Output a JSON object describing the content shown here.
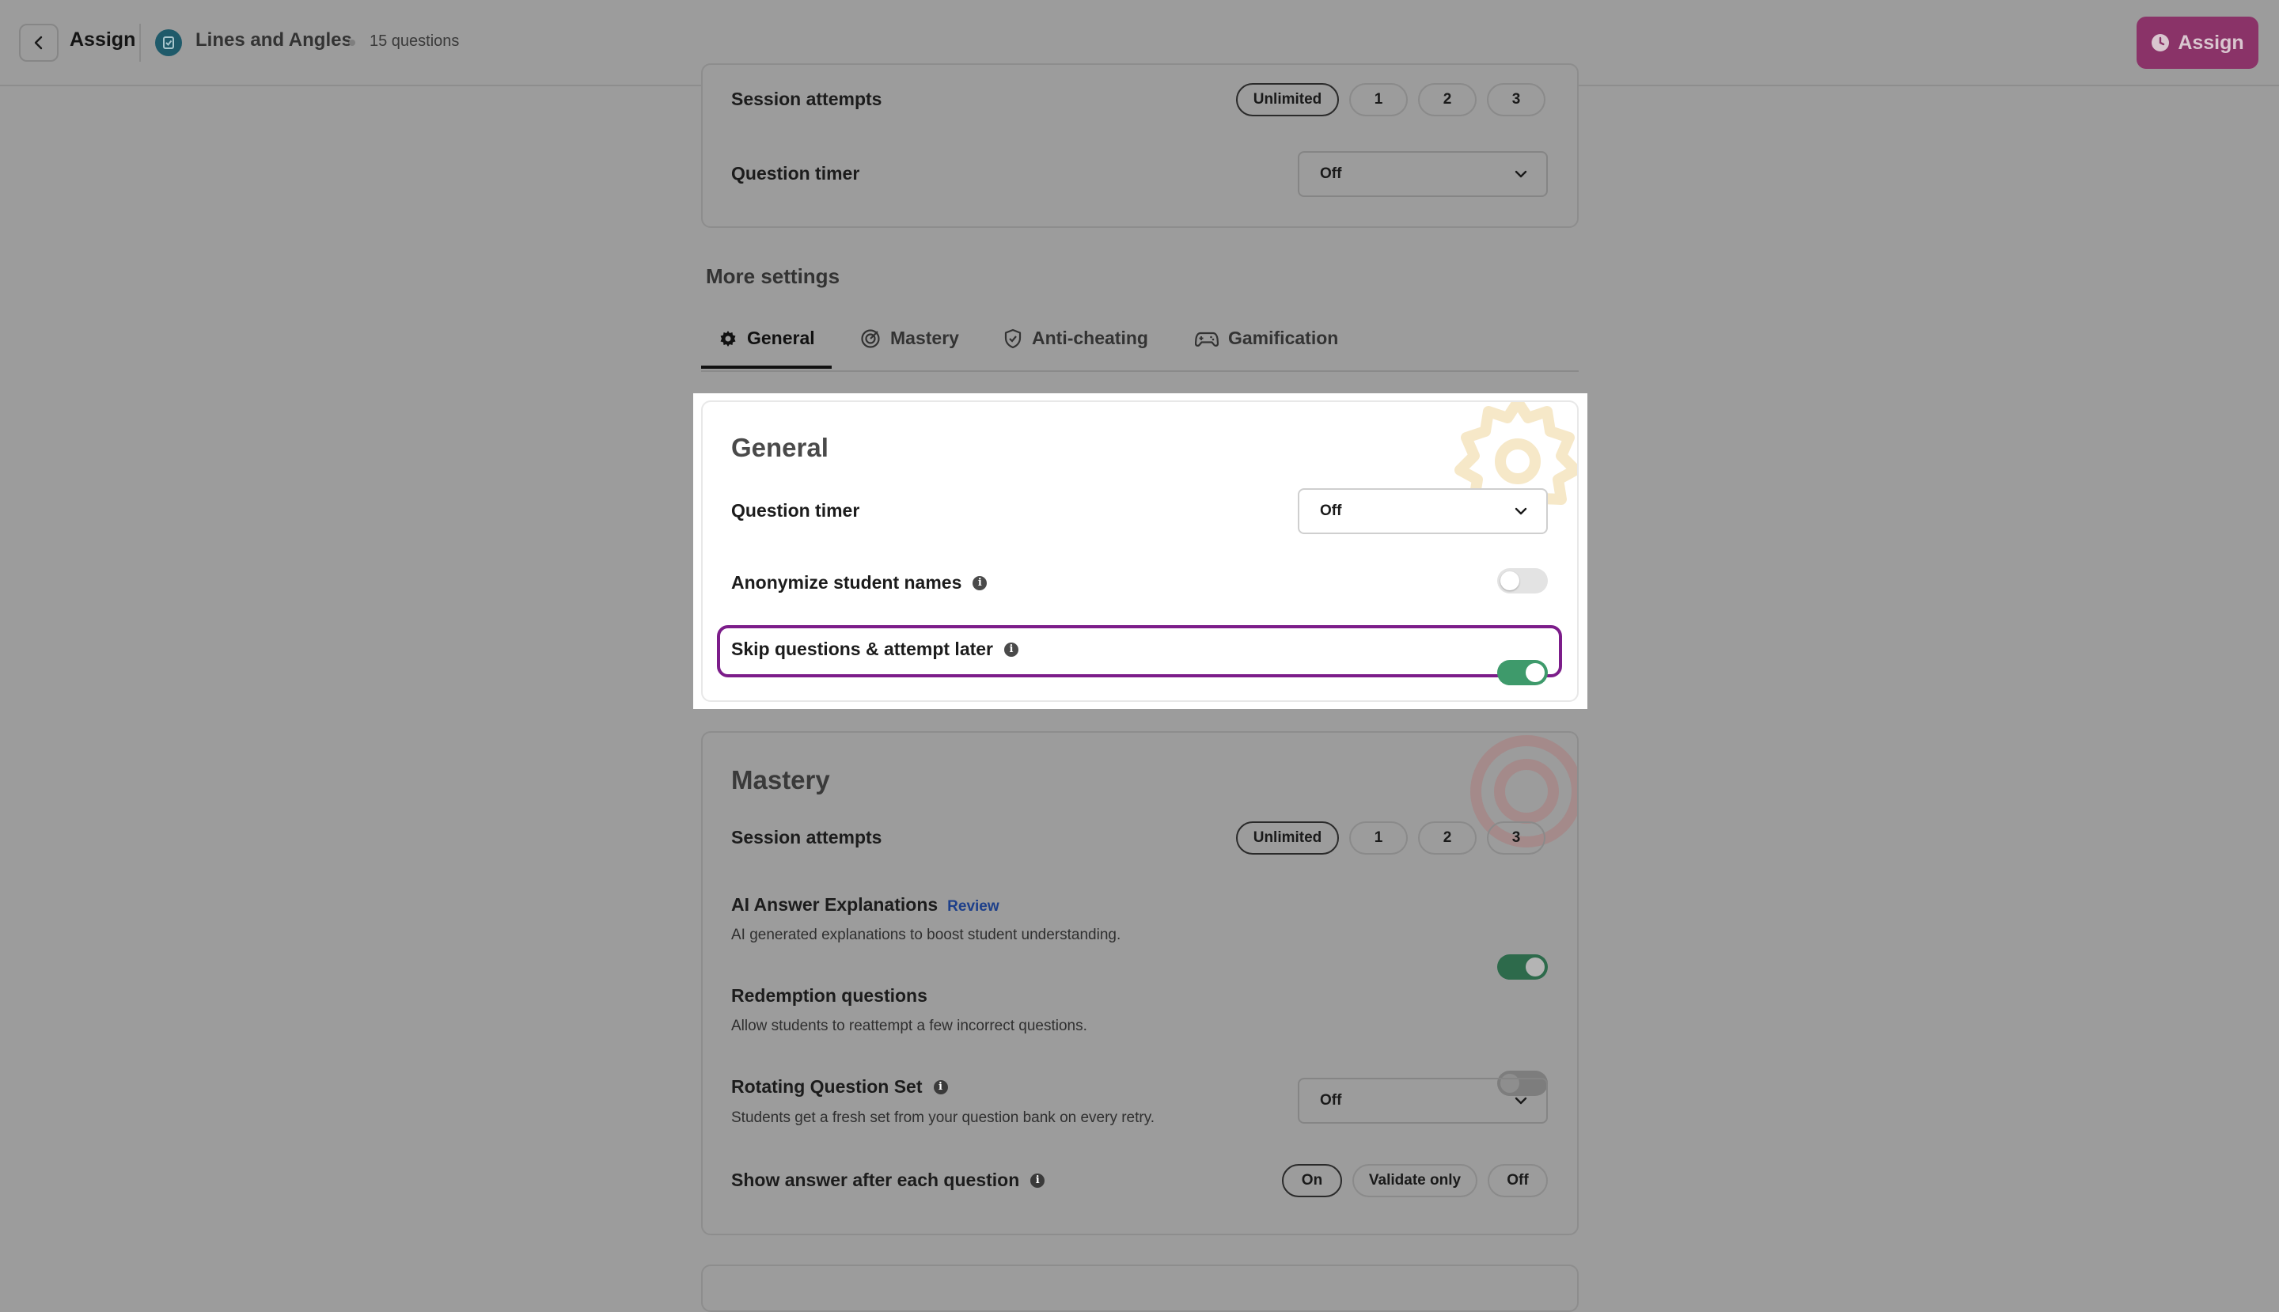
{
  "topbar": {
    "back_label": "Assign",
    "quiz_title": "Lines and Angles",
    "question_count": "15 questions",
    "assign_button": "Assign"
  },
  "top_card": {
    "session_attempts_label": "Session attempts",
    "attempt_options": [
      "Unlimited",
      "1",
      "2",
      "3"
    ],
    "selected_attempt": "Unlimited",
    "question_timer_label": "Question timer",
    "question_timer_value": "Off"
  },
  "more_settings": {
    "title": "More settings",
    "tabs": [
      {
        "label": "General",
        "icon": "gear-icon",
        "active": true
      },
      {
        "label": "Mastery",
        "icon": "target-icon",
        "active": false
      },
      {
        "label": "Anti-cheating",
        "icon": "shield-icon",
        "active": false
      },
      {
        "label": "Gamification",
        "icon": "gamepad-icon",
        "active": false
      }
    ]
  },
  "general": {
    "title": "General",
    "question_timer_label": "Question timer",
    "question_timer_value": "Off",
    "anonymize_label": "Anonymize student names",
    "anonymize_on": false,
    "skip_label": "Skip questions & attempt later",
    "skip_on": true
  },
  "mastery": {
    "title": "Mastery",
    "session_attempts_label": "Session attempts",
    "attempt_options": [
      "Unlimited",
      "1",
      "2",
      "3"
    ],
    "selected_attempt": "Unlimited",
    "ai_label": "AI Answer Explanations",
    "ai_review_link": "Review",
    "ai_sub": "AI generated explanations to boost student understanding.",
    "ai_on": true,
    "redemption_label": "Redemption questions",
    "redemption_sub": "Allow students to reattempt a few incorrect questions.",
    "redemption_on": false,
    "rotating_label": "Rotating Question Set",
    "rotating_sub": "Students get a fresh set from your question bank on every retry.",
    "rotating_value": "Off",
    "show_answer_label": "Show answer after each question",
    "show_answer_options": [
      "On",
      "Validate only",
      "Off"
    ],
    "show_answer_selected": "On"
  },
  "colors": {
    "overlay_gray": "#9c9c9c",
    "assign_button": "#8a3368",
    "toggle_on": "#3e9a6b",
    "focus_ring": "#7c1d8a",
    "review_link": "#1d3f8a"
  }
}
